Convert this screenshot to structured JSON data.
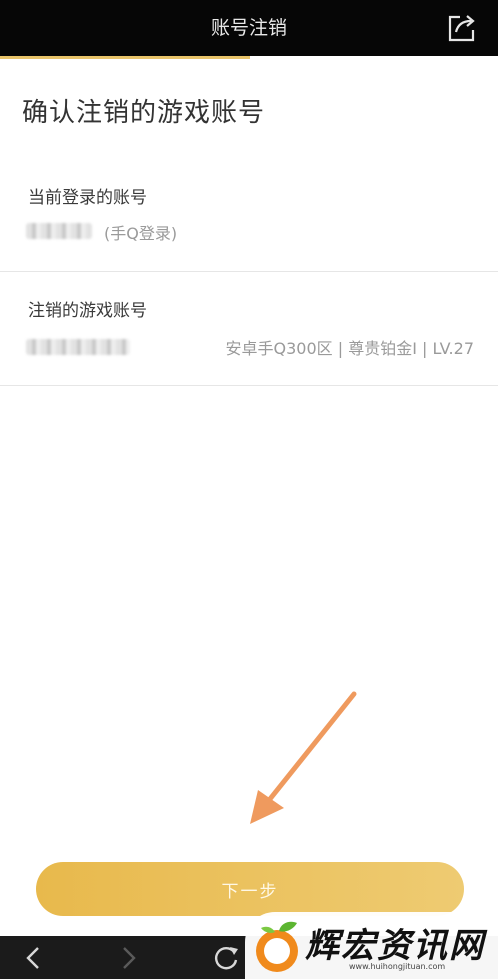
{
  "header": {
    "title": "账号注销"
  },
  "page": {
    "heading": "确认注销的游戏账号"
  },
  "current_account": {
    "label": "当前登录的账号",
    "login_method": "(手Q登录)"
  },
  "game_account": {
    "label": "注销的游戏账号",
    "server_info": "安卓手Q300区 | 尊贵铂金I | LV.27"
  },
  "actions": {
    "next_label": "下一步"
  },
  "watermark": {
    "text": "辉宏资讯网",
    "url": "www.huihongjituan.com"
  },
  "colors": {
    "accent": "#e9c46a",
    "header_bg": "#060606",
    "arrow": "#ef9a5e"
  },
  "icons": {
    "share": "share-icon",
    "back": "back-arrow-icon",
    "forward": "forward-arrow-icon",
    "refresh": "refresh-icon"
  }
}
